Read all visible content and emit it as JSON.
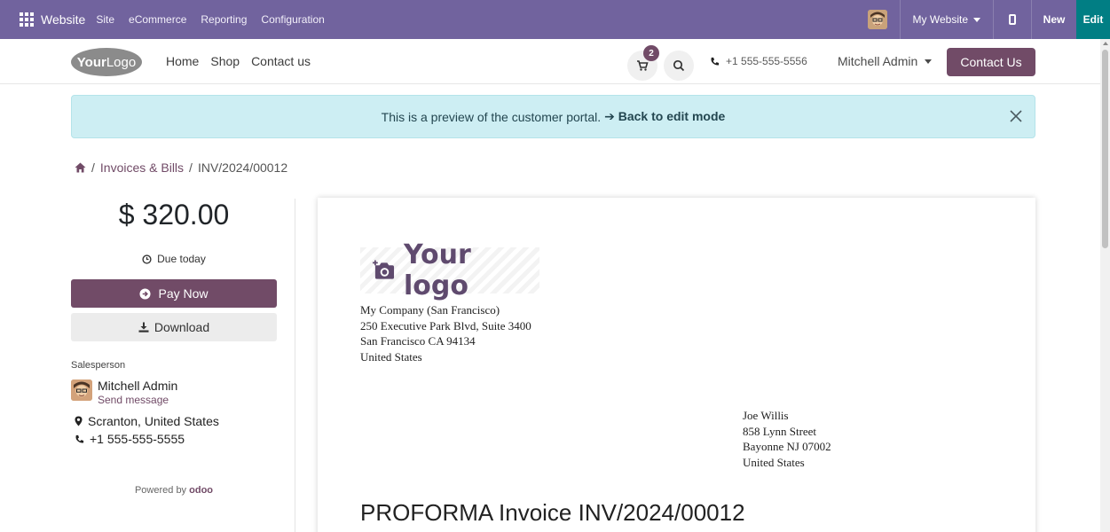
{
  "adminbar": {
    "brand": "Website",
    "menu": [
      "Site",
      "eCommerce",
      "Reporting",
      "Configuration"
    ],
    "website_selector": "My Website",
    "new_label": "New",
    "edit_label": "Edit",
    "colors": {
      "bar": "#71639e",
      "edit": "#017e84"
    }
  },
  "header": {
    "logo_bold": "Your",
    "logo_rest": "Logo",
    "nav": [
      "Home",
      "Shop",
      "Contact us"
    ],
    "cart_count": "2",
    "phone": "+1 555-555-5556",
    "user": "Mitchell Admin",
    "contact_button": "Contact Us",
    "icons": [
      "cart-icon",
      "search-icon",
      "phone-icon",
      "chevron-down-icon"
    ]
  },
  "alert": {
    "text": "This is a preview of the customer portal.",
    "link": "➔ Back to edit mode"
  },
  "breadcrumb": {
    "section": "Invoices & Bills",
    "current": "INV/2024/00012"
  },
  "sidebar": {
    "amount": "$ 320.00",
    "due": "Due today",
    "pay_now": "Pay Now",
    "download": "Download",
    "salesperson_label": "Salesperson",
    "salesperson_name": "Mitchell Admin",
    "send_message": "Send message",
    "location": "Scranton, United States",
    "phone": "+1 555-555-5555",
    "powered_by": "Powered by",
    "powered_brand": "odoo"
  },
  "invoice": {
    "logo_text": "Your logo",
    "company_lines": [
      "My Company (San Francisco)",
      "250 Executive Park Blvd, Suite 3400",
      "San Francisco CA 94134",
      "United States"
    ],
    "customer_lines": [
      "Joe Willis",
      "858 Lynn Street",
      "Bayonne NJ 07002",
      "United States"
    ],
    "title": "PROFORMA Invoice INV/2024/00012"
  },
  "colors": {
    "primary": "#714b67",
    "alert_bg": "#cdeef3"
  }
}
